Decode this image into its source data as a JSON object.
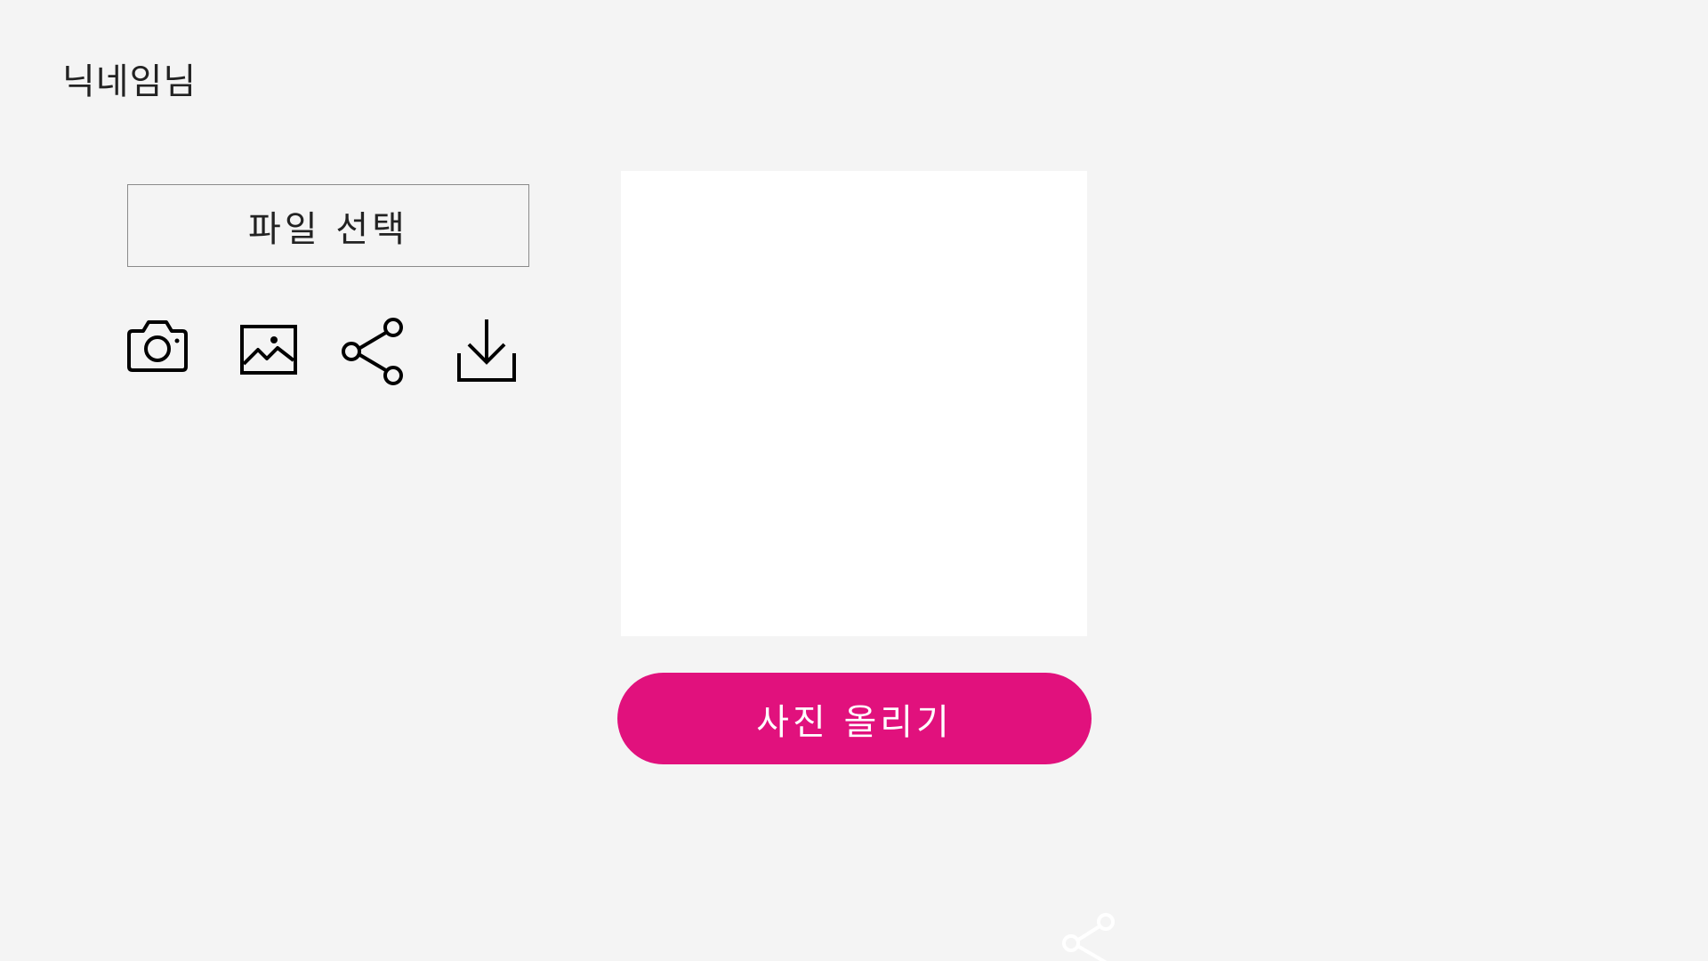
{
  "header": {
    "nickname": "닉네임님"
  },
  "toolbar": {
    "file_select_label": "파일 선택",
    "icons": [
      "camera-icon",
      "image-icon",
      "share-icon",
      "download-icon"
    ]
  },
  "main": {
    "upload_label": "사진 올리기"
  },
  "colors": {
    "accent": "#e1117d",
    "background": "#f4f4f4",
    "preview_bg": "#ffffff"
  }
}
